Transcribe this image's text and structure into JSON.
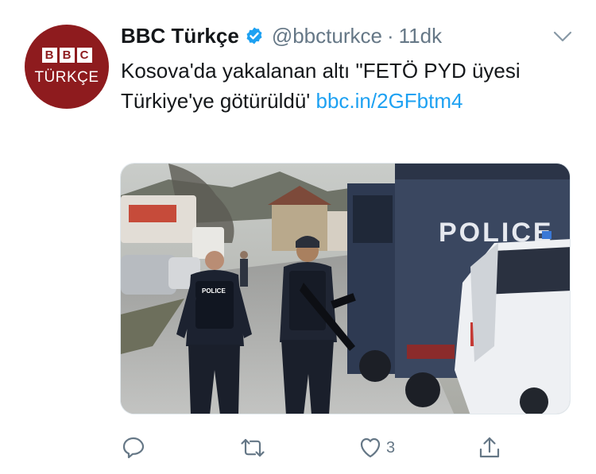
{
  "avatar": {
    "letters": [
      "B",
      "B",
      "C"
    ],
    "word": "TÜRKÇE",
    "brand_color": "#8e1b1e"
  },
  "tweet": {
    "display_name": "BBC Türkçe",
    "verified_icon": "verified-badge-icon",
    "handle": "@bbcturkce",
    "separator": "·",
    "time": "11dk",
    "text": "Kosova'da yakalanan altı \"FETÖ PYD üyesi Türkiye'ye götürüldü' ",
    "link_text": "bbc.in/2GFbtm4",
    "link_color": "#1da1f2"
  },
  "media": {
    "kind": "photo",
    "vehicle_label": "POLICE",
    "vest_label": "POLICE"
  },
  "actions": {
    "reply_icon": "reply-icon",
    "retweet_icon": "retweet-icon",
    "like_icon": "heart-icon",
    "like_count": "3",
    "share_icon": "share-icon"
  }
}
